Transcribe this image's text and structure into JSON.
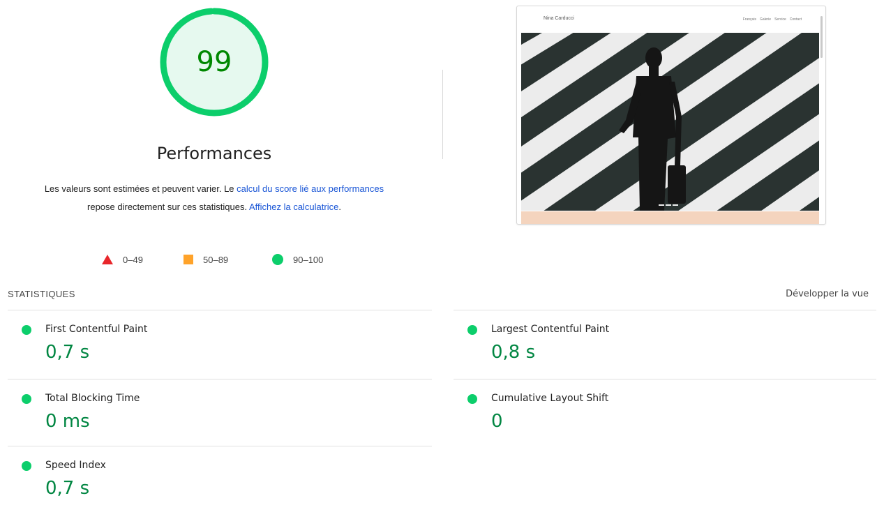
{
  "score": {
    "value": "99",
    "value_number": 99,
    "title": "Performances",
    "color": "#0cce6b"
  },
  "description": {
    "text1": "Les valeurs sont estimées et peuvent varier. Le ",
    "link1": "calcul du score lié aux performances",
    "text2": " repose directement sur ces statistiques. ",
    "link2": "Affichez la calculatrice",
    "text3": "."
  },
  "legend": [
    {
      "range": "0–49",
      "shape": "triangle",
      "color": "#e8262b"
    },
    {
      "range": "50–89",
      "shape": "square",
      "color": "#ffa32a"
    },
    {
      "range": "90–100",
      "shape": "circle",
      "color": "#0cce6b"
    }
  ],
  "screenshot": {
    "brand": "Nina Carducci",
    "nav": [
      "Français",
      "Galerie",
      "Service",
      "Contact"
    ]
  },
  "stats": {
    "title": "STATISTIQUES",
    "expand_label": "Développer la vue",
    "metrics": [
      {
        "label": "First Contentful Paint",
        "value": "0,7 s"
      },
      {
        "label": "Largest Contentful Paint",
        "value": "0,8 s"
      },
      {
        "label": "Total Blocking Time",
        "value": "0 ms"
      },
      {
        "label": "Cumulative Layout Shift",
        "value": "0"
      },
      {
        "label": "Speed Index",
        "value": "0,7 s"
      }
    ]
  }
}
